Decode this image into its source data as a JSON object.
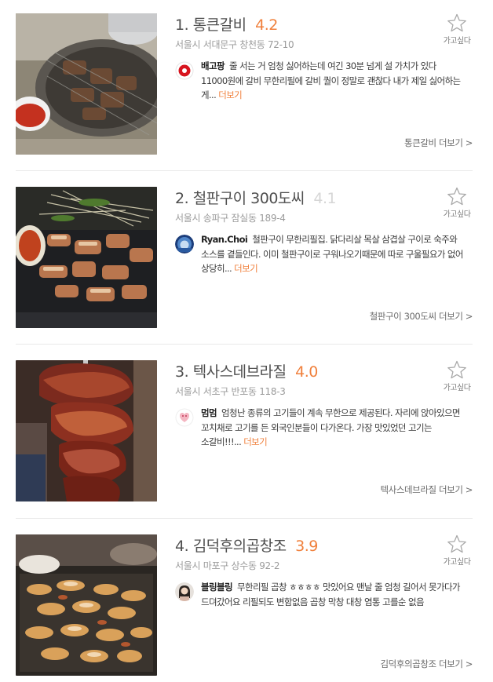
{
  "restaurants": [
    {
      "rank": "1.",
      "name": "통큰갈비",
      "score": "4.2",
      "address": "서울시 서대문구 창천동 72-10",
      "want_label": "가고싶다",
      "review": {
        "author": "배고팡",
        "text": "줄 서는 거 엄청 싫어하는데 여긴 30분 넘게 설 가치가 있다 11000원에 갈비 무한리필에 갈비 퀄이 정말로 괜찮다 내가 제일 싫어하는 게...",
        "more_label": "더보기"
      },
      "detail_link": "통큰갈비 더보기 >"
    },
    {
      "rank": "2.",
      "name": "철판구이 300도씨",
      "score": "4.1",
      "address": "서울시 송파구 잠실동 189-4",
      "want_label": "가고싶다",
      "review": {
        "author": "Ryan.Choi",
        "text": "철판구이 무한리필집. 닭다리살 목살 삼겹살 구이로 숙주와 소스를 곁들인다. 이미 철판구이로 구워나오기때문에 따로 구울필요가 없어 상당히...",
        "more_label": "더보기"
      },
      "detail_link": "철판구이 300도씨 더보기 >"
    },
    {
      "rank": "3.",
      "name": "텍사스데브라질",
      "score": "4.0",
      "address": "서울시 서초구 반포동 118-3",
      "want_label": "가고싶다",
      "review": {
        "author": "멈멈",
        "text": "엄청난 종류의 고기들이 계속 무한으로 제공된다. 자리에 앉아있으면 꼬치채로 고기를 든 외국인분들이 다가온다. 가장 맛있었던 고기는 소갈비!!!...",
        "more_label": "더보기"
      },
      "detail_link": "텍사스데브라질 더보기 >"
    },
    {
      "rank": "4.",
      "name": "김덕후의곱창조",
      "score": "3.9",
      "address": "서울시 마포구 상수동 92-2",
      "want_label": "가고싶다",
      "review": {
        "author": "블링블링",
        "text": "무한리필 곱창 ㅎㅎㅎㅎ 맛있어요 맨날 줄 엄청 길어서 못가다가 드뎌갔어요 리필되도 변함없음 곱창 막창 대창 염통 고를순 없음",
        "more_label": ""
      },
      "detail_link": "김덕후의곱창조 더보기 >"
    }
  ],
  "colors": {
    "accent": "#f0803c",
    "score_muted": "#d6d6d6",
    "divider": "#e9e9e9"
  },
  "icons": {
    "want": "star-outline-icon"
  }
}
